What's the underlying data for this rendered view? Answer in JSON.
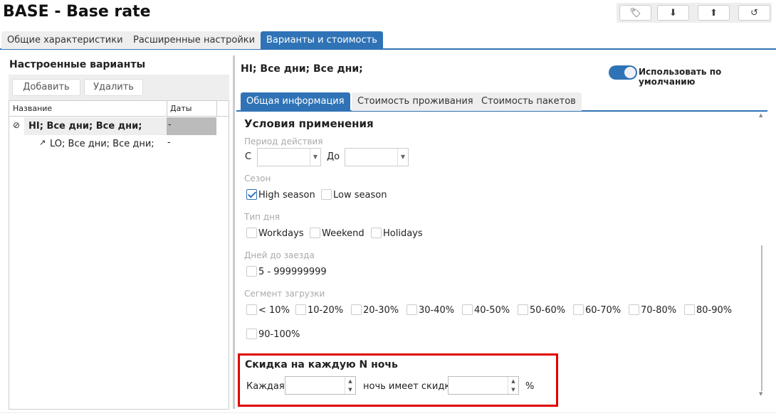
{
  "header": {
    "title": "BASE - Base rate",
    "toolbar": [
      {
        "icon": "tag-icon",
        "glyph": "🏷"
      },
      {
        "icon": "download-icon",
        "glyph": "⬇"
      },
      {
        "icon": "upload-icon",
        "glyph": "⬆"
      },
      {
        "icon": "history-icon",
        "glyph": "↺"
      }
    ]
  },
  "tabs": [
    {
      "label": "Общие характеристики"
    },
    {
      "label": "Расширенные настройки"
    },
    {
      "label": "Варианты и стоимость",
      "active": true
    }
  ],
  "left": {
    "title": "Настроенные варианты",
    "add": "Добавить",
    "delete": "Удалить",
    "columns": [
      "Название",
      "Даты"
    ],
    "rows": [
      {
        "name": "HI; Все дни; Все дни;",
        "dates": "-",
        "selected": true
      },
      {
        "name": "LO; Все дни; Все дни;",
        "dates": "-"
      }
    ]
  },
  "right": {
    "title": "HI; Все дни; Все дни;",
    "default_toggle": {
      "label": "Использовать по умолчанию",
      "on": true
    },
    "subtabs": [
      {
        "label": "Общая информация",
        "active": true
      },
      {
        "label": "Стоимость проживания"
      },
      {
        "label": "Стоимость пакетов"
      }
    ],
    "conditions": {
      "title": "Условия применения",
      "period_label": "Период действия",
      "from": "С",
      "to": "До",
      "from_value": "",
      "to_value": "",
      "season_label": "Сезон",
      "seasons": [
        {
          "label": "High season",
          "checked": true
        },
        {
          "label": "Low season",
          "checked": false
        }
      ],
      "daytype_label": "Тип дня",
      "daytypes": [
        {
          "label": "Workdays"
        },
        {
          "label": "Weekend"
        },
        {
          "label": "Holidays"
        }
      ],
      "days_label": "Дней до заезда",
      "days": [
        {
          "label": "5 - 999999999"
        }
      ],
      "load_label": "Сегмент загрузки",
      "loads": [
        "< 10%",
        "10-20%",
        "20-30%",
        "30-40%",
        "40-50%",
        "50-60%",
        "60-70%",
        "70-80%",
        "80-90%",
        "90-100%"
      ]
    },
    "discount": {
      "title": "Скидка на каждую N ночь",
      "every": "Каждая",
      "night_has": "ночь имеет скидку",
      "percent": "%",
      "n_value": "",
      "pct_value": ""
    }
  },
  "colors": {
    "accent": "#2f73b6",
    "highlight": "#e00000"
  }
}
